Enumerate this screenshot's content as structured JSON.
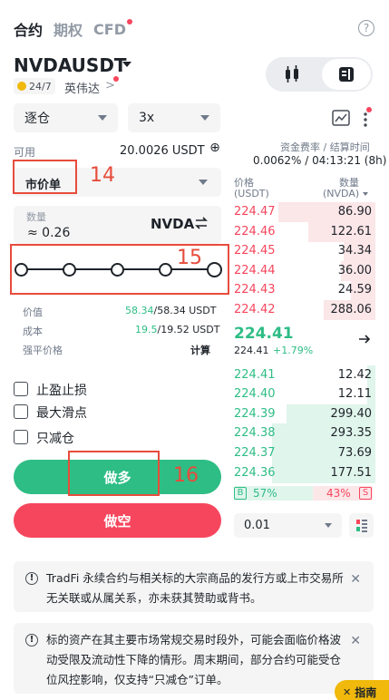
{
  "top_tabs": [
    "合约",
    "期权",
    "CFD"
  ],
  "help_icon": "?",
  "symbol": {
    "name": "NVDAUSDT",
    "badge": "24/7",
    "sub_name": "英伟达",
    "sub_chevron": ">"
  },
  "view_toggle": {
    "left": "chart-candles-icon",
    "right": "orderbook-icon"
  },
  "margin_mode": "逐仓",
  "leverage": "3x",
  "available": {
    "label": "可用",
    "value": "20.0026 USDT",
    "plus": "⊕"
  },
  "funding": {
    "label": "资金费率 / 结算时间",
    "value": "0.0062% / 04:13:21 (8h)"
  },
  "order_type": "市价单",
  "quantity": {
    "label": "数量",
    "value": "≈ 0.26",
    "unit": "NVDA"
  },
  "slider": {
    "stops": 5,
    "value": 1.0
  },
  "info": {
    "value_label": "价值",
    "value_green": "58.34",
    "value_rest": "/58.34 USDT",
    "cost_label": "成本",
    "cost_green": "19.5",
    "cost_rest": "/19.52 USDT",
    "liq_label": "强平价格",
    "liq_value": "计算"
  },
  "checkboxes": [
    "止盈止损",
    "最大滑点",
    "只减仓"
  ],
  "buttons": {
    "long": "做多",
    "short": "做空"
  },
  "annotations": {
    "n14": "14",
    "n15": "15",
    "n16": "16"
  },
  "orderbook": {
    "price_header_1": "价格",
    "price_header_2": "(USDT)",
    "qty_header_1": "数量",
    "qty_header_2": "(NVDA)",
    "asks": [
      {
        "price": "224.47",
        "qty": "86.90",
        "depth": 0.68
      },
      {
        "price": "224.46",
        "qty": "122.61",
        "depth": 0.47
      },
      {
        "price": "224.45",
        "qty": "34.34",
        "depth": 0.22
      },
      {
        "price": "224.44",
        "qty": "36.00",
        "depth": 0.24
      },
      {
        "price": "224.43",
        "qty": "24.59",
        "depth": 0.17
      },
      {
        "price": "224.42",
        "qty": "288.06",
        "depth": 0.36
      }
    ],
    "last_price": "224.41",
    "mark_price": "224.41",
    "change": "+1.79%",
    "bids": [
      {
        "price": "224.41",
        "qty": "12.42",
        "depth": 0.06
      },
      {
        "price": "224.40",
        "qty": "12.11",
        "depth": 0.06
      },
      {
        "price": "224.39",
        "qty": "299.40",
        "depth": 0.62
      },
      {
        "price": "224.38",
        "qty": "293.35",
        "depth": 0.72
      },
      {
        "price": "224.37",
        "qty": "73.69",
        "depth": 0.72
      },
      {
        "price": "224.36",
        "qty": "177.51",
        "depth": 0.72
      }
    ],
    "buy_ratio": "57%",
    "sell_ratio": "43%",
    "buy_label": "B",
    "sell_label": "S",
    "depth_step": "0.01"
  },
  "notices": [
    "TradFi 永续合约与相关标的大宗商品的发行方或上市交易所无关联或从属关系，亦未获其赞助或背书。",
    "标的资产在其主要市场常规交易时段外，可能会面临价格波动受限及流动性下降的情形。周末期间，部分合约可能受仓位风控影响，仅支持“只减仓”订单。"
  ],
  "guide_button": "指南",
  "colors": {
    "green": "#2ebd85",
    "red": "#f6465d",
    "yellow": "#f0b90b",
    "annotation": "#e74c3c"
  }
}
